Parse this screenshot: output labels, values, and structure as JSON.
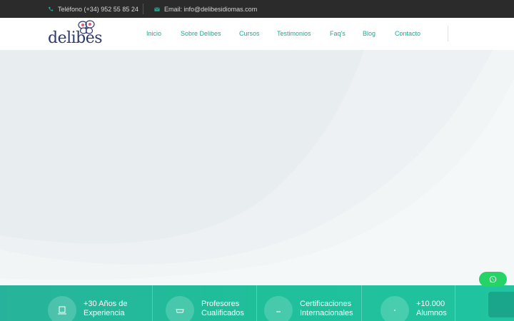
{
  "topbar": {
    "phone_label": "Teléfono (+34) 952 55 85 24",
    "email_label": "Email: info@delibesidiomas.com"
  },
  "header": {
    "logo_text": "delibes",
    "nav": [
      "Inicio",
      "Sobre Delibes",
      "Cursos",
      "Testimonios",
      "Faq's",
      "Blog",
      "Contacto"
    ]
  },
  "features": [
    {
      "line1": "+30 Años de",
      "line2": "Experiencia",
      "icon": "book-icon"
    },
    {
      "line1": "Profesores",
      "line2": "Cualificados",
      "icon": "teacher-icon"
    },
    {
      "line1": "Certificaciones",
      "line2": "Internacionales",
      "icon": "certificate-icon"
    },
    {
      "line1": "+10.000",
      "line2": "Alumnos",
      "icon": "students-icon"
    }
  ],
  "colors": {
    "accent": "#1fa890",
    "topbar_bg": "#2b2b2b",
    "features_bg": "#27b39b",
    "whatsapp": "#25d366"
  }
}
